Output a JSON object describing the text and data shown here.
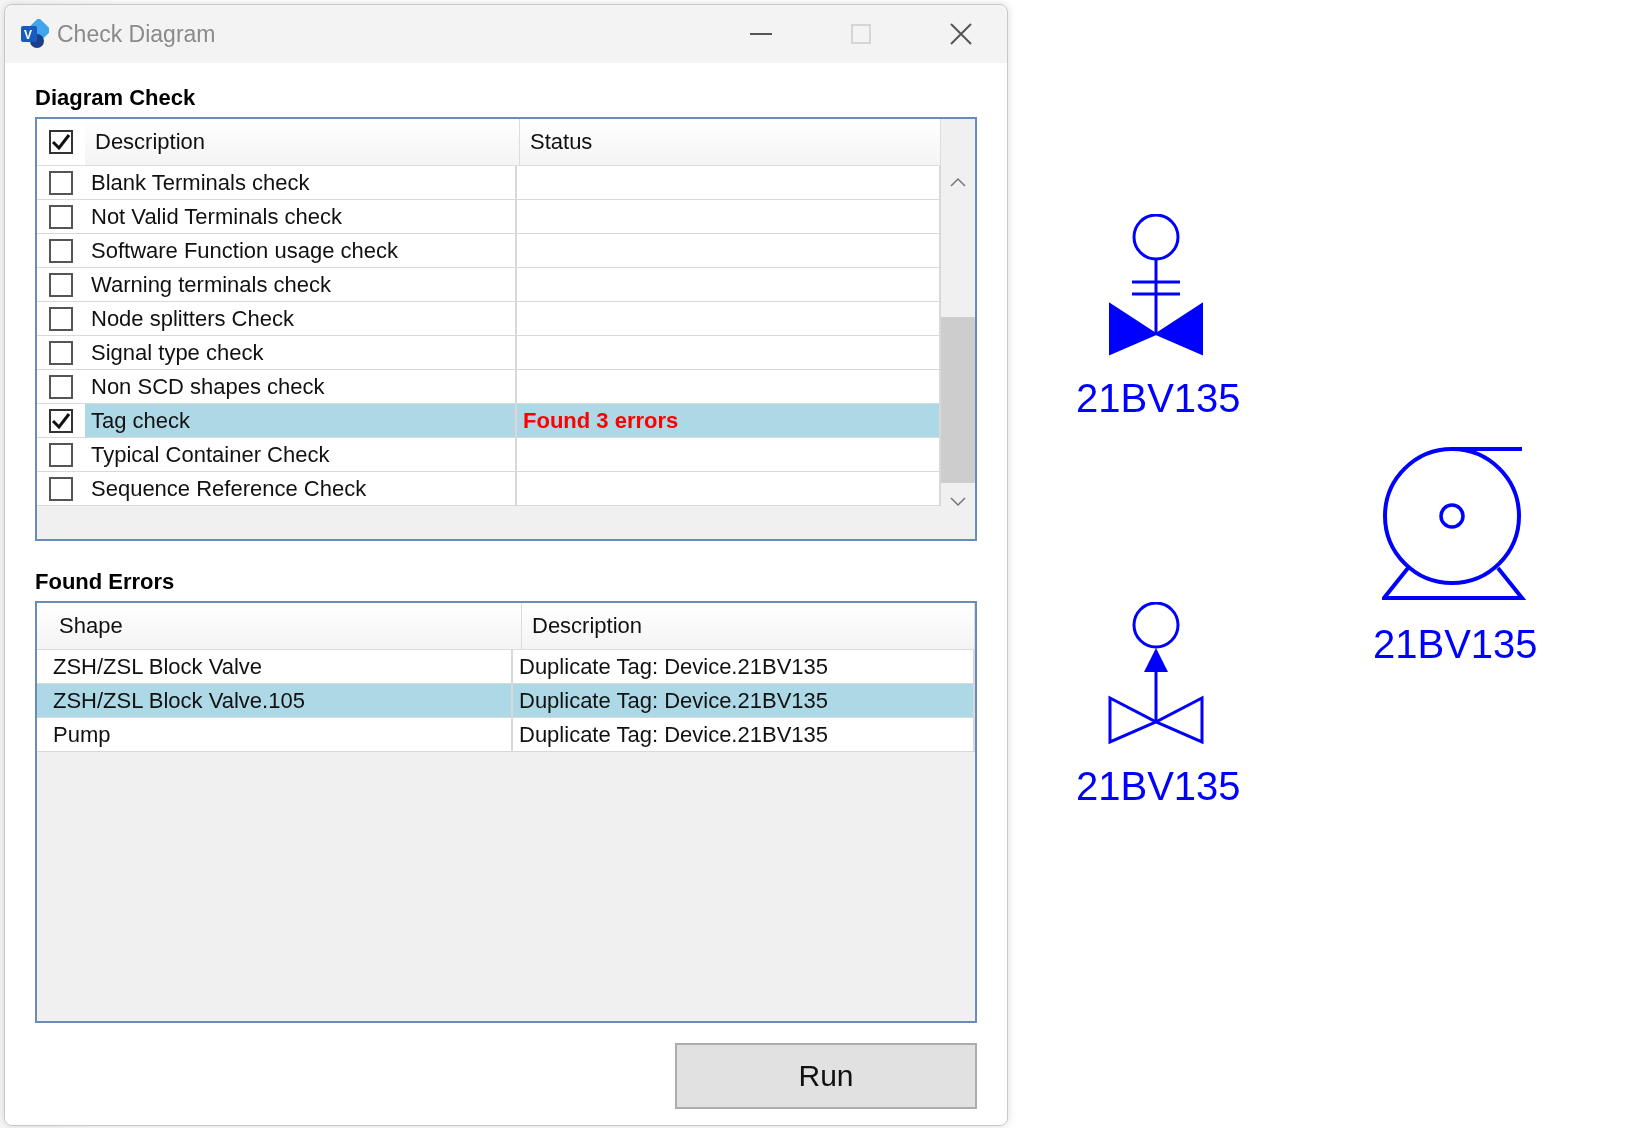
{
  "window": {
    "title": "Check Diagram",
    "logo_letter": "V"
  },
  "diagram_check": {
    "label": "Diagram Check",
    "header_checked": true,
    "columns": [
      "Description",
      "Status"
    ],
    "rows": [
      {
        "description": "Blank Terminals check",
        "checked": false,
        "selected": false
      },
      {
        "description": "Not Valid Terminals check",
        "checked": false,
        "selected": false
      },
      {
        "description": "Software Function usage check",
        "checked": false,
        "selected": false
      },
      {
        "description": "Warning terminals check",
        "checked": false,
        "selected": false
      },
      {
        "description": "Node splitters Check",
        "checked": false,
        "selected": false
      },
      {
        "description": "Signal type check",
        "checked": false,
        "selected": false
      },
      {
        "description": "Non SCD shapes check",
        "checked": false,
        "selected": false
      },
      {
        "description": "Tag check",
        "checked": true,
        "selected": true,
        "status": "Found 3 errors"
      },
      {
        "description": "Typical Container Check",
        "checked": false,
        "selected": false
      },
      {
        "description": "Sequence Reference Check",
        "checked": false,
        "selected": false
      }
    ]
  },
  "found_errors": {
    "label": "Found Errors",
    "columns": [
      "Shape",
      "Description"
    ],
    "rows": [
      {
        "shape": "ZSH/ZSL Block Valve",
        "description": "Duplicate Tag: Device.21BV135",
        "selected": false
      },
      {
        "shape": "ZSH/ZSL Block Valve.105",
        "description": "Duplicate Tag: Device.21BV135",
        "selected": true
      },
      {
        "shape": "Pump",
        "description": "Duplicate Tag: Device.21BV135",
        "selected": false
      }
    ]
  },
  "run_button": "Run",
  "diagram": {
    "shapes": [
      {
        "kind": "manual_valve",
        "tag": "21BV135"
      },
      {
        "kind": "pump",
        "tag": "21BV135"
      },
      {
        "kind": "control_valve",
        "tag": "21BV135"
      }
    ]
  }
}
